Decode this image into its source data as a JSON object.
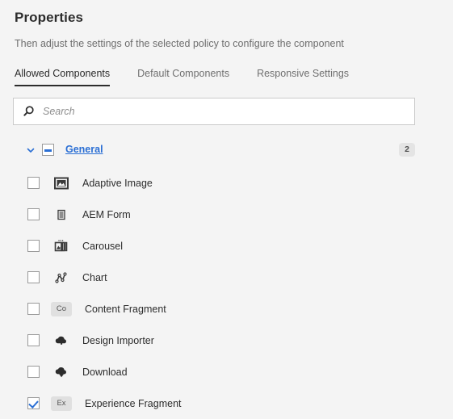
{
  "header": {
    "title": "Properties",
    "subtitle": "Then adjust the settings of the selected policy to configure the component"
  },
  "tabs": [
    {
      "label": "Allowed Components",
      "active": true
    },
    {
      "label": "Default Components",
      "active": false
    },
    {
      "label": "Responsive Settings",
      "active": false
    }
  ],
  "search": {
    "placeholder": "Search",
    "value": "",
    "icon": "search-icon"
  },
  "group": {
    "label": "General",
    "badge": "2",
    "expanded": true,
    "checkbox_state": "indeterminate",
    "chevron_icon": "chevron-down-icon"
  },
  "components": [
    {
      "label": "Adaptive Image",
      "icon": "image-icon",
      "icon_type": "svg",
      "checked": false
    },
    {
      "label": "AEM Form",
      "icon": "form-document-icon",
      "icon_type": "svg",
      "checked": false
    },
    {
      "label": "Carousel",
      "icon": "carousel-icon",
      "icon_type": "svg",
      "checked": false
    },
    {
      "label": "Chart",
      "icon": "chart-line-icon",
      "icon_type": "svg",
      "checked": false
    },
    {
      "label": "Content Fragment",
      "icon": "content-fragment-tag-icon",
      "icon_type": "tag",
      "tag_text": "Co",
      "checked": false
    },
    {
      "label": "Design Importer",
      "icon": "cloud-upload-icon",
      "icon_type": "svg",
      "checked": false
    },
    {
      "label": "Download",
      "icon": "cloud-download-icon",
      "icon_type": "svg",
      "checked": false
    },
    {
      "label": "Experience Fragment",
      "icon": "experience-fragment-tag-icon",
      "icon_type": "tag",
      "tag_text": "Ex",
      "checked": true
    }
  ],
  "colors": {
    "background": "#f4f4f4",
    "accent_blue": "#2b6fd4",
    "text": "#2c2c2c",
    "muted_text": "#6e6e6e",
    "badge_bg": "#e4e4e4"
  }
}
